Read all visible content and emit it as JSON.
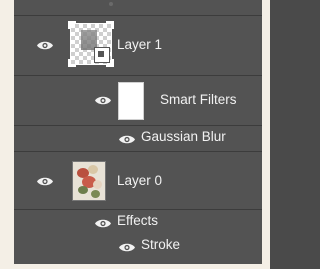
{
  "layers_panel": {
    "layers": [
      {
        "name": "Layer 1",
        "visible": true,
        "type": "smart-object",
        "smart_filters": {
          "label": "Smart Filters",
          "visible": true,
          "filters": [
            {
              "name": "Gaussian Blur",
              "visible": true
            }
          ]
        }
      },
      {
        "name": "Layer 0",
        "visible": true,
        "type": "image",
        "effects": {
          "label": "Effects",
          "visible": true,
          "items": [
            {
              "name": "Stroke",
              "visible": true
            }
          ]
        }
      }
    ]
  },
  "colors": {
    "panel_bg": "#535353",
    "text": "#f2f2f2",
    "divider": "#3c3c3c",
    "frame": "#f4efe6"
  },
  "icons": {
    "visibility": "eye-icon",
    "smart_object_badge": "smart-object-badge-icon"
  }
}
